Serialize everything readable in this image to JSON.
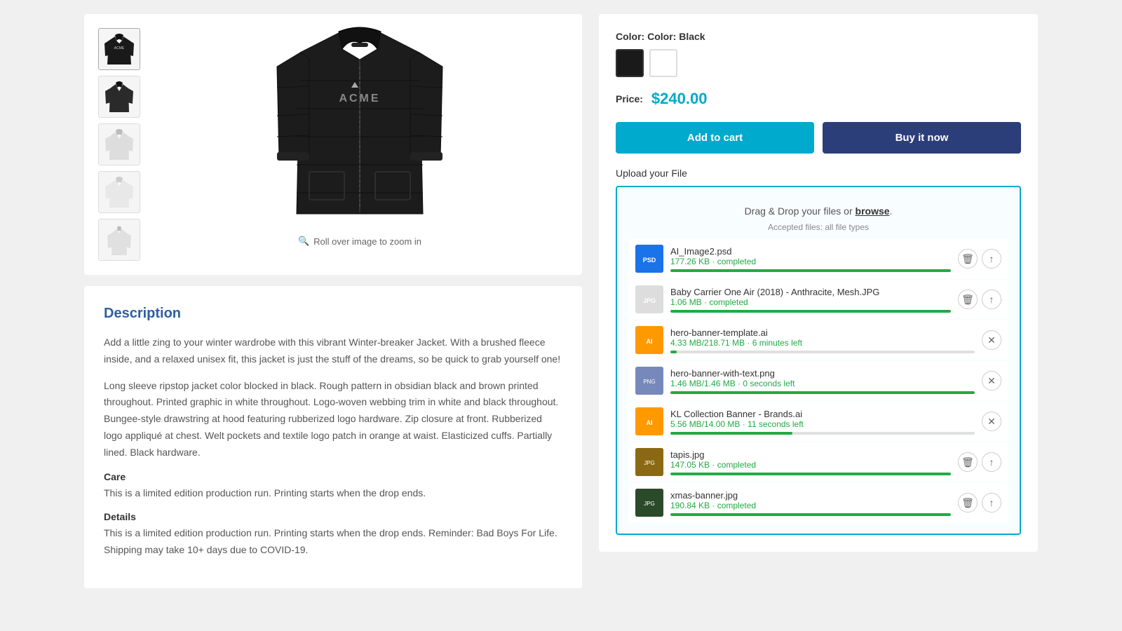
{
  "product": {
    "color_label": "Color:",
    "color_value": "Black",
    "price_label": "Price:",
    "price_value": "$240.00",
    "add_to_cart": "Add to cart",
    "buy_it_now": "Buy it now",
    "upload_label": "Upload your File",
    "dropzone_text": "Drag & Drop your files or",
    "dropzone_browse": "browse",
    "dropzone_period": ".",
    "dropzone_accepted": "Accepted files: all file types",
    "zoom_hint": "Roll over image to zoom in"
  },
  "thumbnails": [
    {
      "id": "thumb-1",
      "label": "Black jacket front",
      "active": true,
      "bg": "#2a2a2a"
    },
    {
      "id": "thumb-2",
      "label": "Black jacket side",
      "active": false,
      "bg": "#2a2a2a"
    },
    {
      "id": "thumb-3",
      "label": "White jacket front",
      "active": false,
      "bg": "#cccccc"
    },
    {
      "id": "thumb-4",
      "label": "White jacket back",
      "active": false,
      "bg": "#cccccc"
    },
    {
      "id": "thumb-5",
      "label": "White jacket detail",
      "active": false,
      "bg": "#cccccc"
    }
  ],
  "description": {
    "title": "Description",
    "para1": "Add a little zing to your winter wardrobe with this vibrant Winter-breaker Jacket. With a brushed fleece inside, and a relaxed unisex fit, this jacket is just the stuff of the dreams, so be quick to grab yourself one!",
    "para2": "Long sleeve ripstop jacket color blocked in black. Rough pattern in obsidian black and brown printed throughout. Printed graphic in white throughout. Logo-woven webbing trim in white and black throughout. Bungee-style drawstring at hood featuring rubberized logo hardware. Zip closure at front. Rubberized logo appliqué at chest. Welt pockets and textile logo patch in orange at waist. Elasticized cuffs. Partially lined. Black hardware.",
    "care_label": "Care",
    "care_text": "This is a limited edition production run. Printing starts when the drop ends.",
    "details_label": "Details",
    "details_text": "This is a limited edition production run. Printing starts when the drop ends. Reminder: Bad Boys For Life. Shipping may take 10+ days due to COVID-19."
  },
  "files": [
    {
      "name": "AI_Image2.psd",
      "status": "177.26 KB · completed",
      "status_type": "completed",
      "progress": 100,
      "has_delete": true,
      "has_upload": true,
      "has_close": false,
      "thumb_type": "psd"
    },
    {
      "name": "Baby Carrier One Air (2018) - Anthracite, Mesh.JPG",
      "status": "1.06 MB · completed",
      "status_type": "completed",
      "progress": 100,
      "has_delete": true,
      "has_upload": true,
      "has_close": false,
      "thumb_type": "jpg"
    },
    {
      "name": "hero-banner-template.ai",
      "status": "4.33 MB/218.71 MB · 6 minutes left",
      "status_type": "uploading",
      "progress": 2,
      "has_delete": false,
      "has_upload": false,
      "has_close": true,
      "thumb_type": "ai"
    },
    {
      "name": "hero-banner-with-text.png",
      "status": "1.46 MB/1.46 MB · 0 seconds left",
      "status_type": "uploading",
      "progress": 100,
      "has_delete": false,
      "has_upload": false,
      "has_close": true,
      "thumb_type": "png",
      "has_preview": true
    },
    {
      "name": "KL Collection Banner - Brands.ai",
      "status": "5.56 MB/14.00 MB · 11 seconds left",
      "status_type": "uploading",
      "progress": 40,
      "has_delete": false,
      "has_upload": false,
      "has_close": true,
      "thumb_type": "ai"
    },
    {
      "name": "tapis.jpg",
      "status": "147.05 KB · completed",
      "status_type": "completed",
      "progress": 100,
      "has_delete": true,
      "has_upload": true,
      "has_close": false,
      "thumb_type": "jpg",
      "has_preview": true
    },
    {
      "name": "xmas-banner.jpg",
      "status": "190.84 KB · completed",
      "status_type": "completed",
      "progress": 100,
      "has_delete": true,
      "has_upload": true,
      "has_close": false,
      "thumb_type": "jpg",
      "has_preview": true
    }
  ],
  "colors": {
    "label": "Color:",
    "swatches": [
      {
        "id": "black",
        "label": "Black",
        "selected": true
      },
      {
        "id": "white",
        "label": "White",
        "selected": false
      }
    ]
  }
}
